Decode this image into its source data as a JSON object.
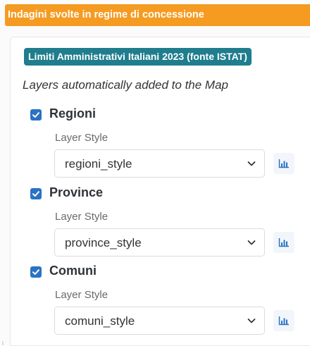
{
  "banner": {
    "title": "Indagini svolte in regime di concessione",
    "color": "#f59b21"
  },
  "panel": {
    "section_badge": "Limiti Amministrativi Italiani 2023 (fonte ISTAT)",
    "badge_color": "#1f7d8d",
    "subtitle": "Layers automatically added to the Map",
    "layers": [
      {
        "name": "Regioni",
        "checked": true,
        "style_label": "Layer Style",
        "style_value": "regioni_style",
        "legend_icon": "bar-chart-icon"
      },
      {
        "name": "Province",
        "checked": true,
        "style_label": "Layer Style",
        "style_value": "province_style",
        "legend_icon": "bar-chart-icon"
      },
      {
        "name": "Comuni",
        "checked": true,
        "style_label": "Layer Style",
        "style_value": "comuni_style",
        "legend_icon": "bar-chart-icon"
      }
    ]
  },
  "colors": {
    "checkbox": "#2a72c4",
    "legend_icon": "#2a72c4"
  }
}
